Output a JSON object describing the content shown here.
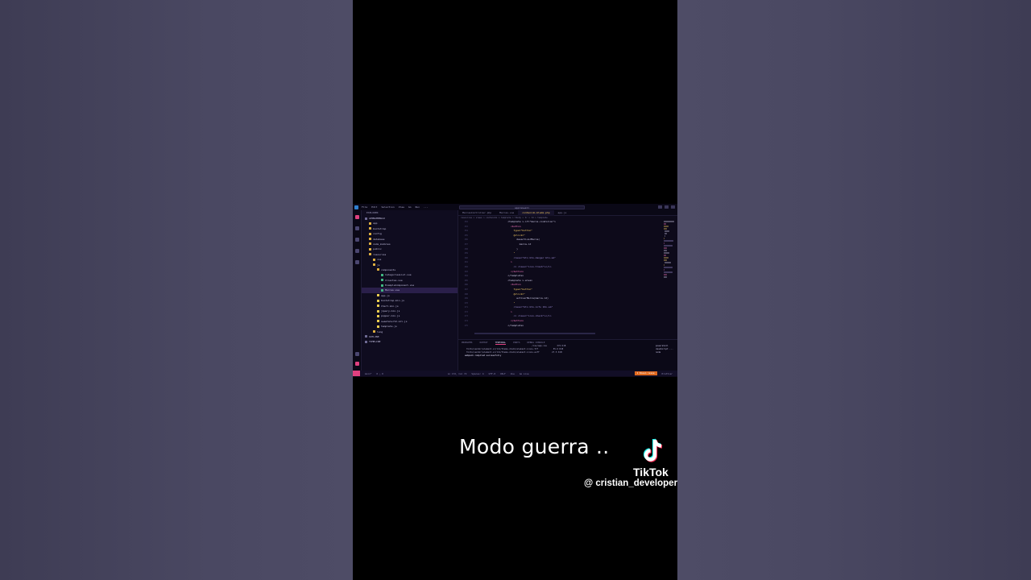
{
  "overlay": {
    "caption": "Modo guerra ..",
    "brand": "TikTok",
    "username": "@ cristian_developer"
  },
  "vscode": {
    "menu": [
      "File",
      "Edit",
      "Selection",
      "View",
      "Go",
      "Run",
      "···"
    ],
    "command_center": "appraswell",
    "sidebar_header": "EXPLORER",
    "tree": [
      {
        "label": "APPNAMEBULD",
        "color": "#6f6b95"
      },
      {
        "label": "app",
        "color": "#e0b040"
      },
      {
        "label": "bootstrap",
        "color": "#e0b040"
      },
      {
        "label": "config",
        "color": "#e0b040"
      },
      {
        "label": "database",
        "color": "#e0b040"
      },
      {
        "label": "node_modules",
        "color": "#e0b040"
      },
      {
        "label": "public",
        "color": "#e0b040"
      },
      {
        "label": "resources",
        "color": "#e0b040"
      },
      {
        "label": "css",
        "color": "#e0b040"
      },
      {
        "label": "js",
        "color": "#e0b040"
      },
      {
        "label": "components",
        "color": "#e0b040"
      },
      {
        "label": "CategoriesList.vue",
        "color": "#41b883"
      },
      {
        "label": "Clientes.vue",
        "color": "#41b883"
      },
      {
        "label": "ExampleComponent.vue",
        "color": "#41b883"
      },
      {
        "label": "Marcas.vue",
        "color": "#41b883"
      },
      {
        "label": "app.js",
        "color": "#f0d050"
      },
      {
        "label": "bootstrap.min.js",
        "color": "#f0d050"
      },
      {
        "label": "Chart.min.js",
        "color": "#f0d050"
      },
      {
        "label": "jquery.min.js",
        "color": "#f0d050"
      },
      {
        "label": "popper.min.js",
        "color": "#f0d050"
      },
      {
        "label": "sweetalert2.all.js",
        "color": "#f0d050"
      },
      {
        "label": "template.js",
        "color": "#f0d050"
      },
      {
        "label": "lang",
        "color": "#e0b040"
      },
      {
        "label": "OUTLINE",
        "color": "#6f6b95"
      },
      {
        "label": "TIMELINE",
        "color": "#6f6b95"
      }
    ],
    "tabs": [
      "MarcasController.php",
      "Marcas.vue",
      "contenido.blade.php",
      "app.js"
    ],
    "active_tab_index": 2,
    "breadcrumbs": "resources > views > contenido > template > tbody > tr > td > template",
    "line_numbers": [
      "152",
      "153",
      "154",
      "155",
      "156",
      "157",
      "158",
      "159",
      "160",
      "161",
      "162",
      "163",
      "164",
      "165",
      "166",
      "167",
      "168",
      "169",
      "170",
      "171",
      "172",
      "173",
      "174",
      "175"
    ],
    "code_lines": [
      {
        "text": "                        <template v-if=\"marca.condicion\">",
        "color": "#d6d2f0"
      },
      {
        "text": "                          <button",
        "color": "#ff7ac6"
      },
      {
        "text": "                            type=\"button\"",
        "color": "#ffd466"
      },
      {
        "text": "                            @click=\"",
        "color": "#ffd466"
      },
      {
        "text": "                              desactivarMarca(",
        "color": "#d6d2f0"
      },
      {
        "text": "                                marca.id",
        "color": "#d6d2f0"
      },
      {
        "text": "                              )",
        "color": "#d6d2f0"
      },
      {
        "text": "                            \"",
        "color": "#ffd466"
      },
      {
        "text": "                            class=\"btn btn-danger btn-sm\"",
        "color": "#9f8fd8"
      },
      {
        "text": "                          >",
        "color": "#ff7ac6"
      },
      {
        "text": "                            <i class=\"icon-trash\"></i>",
        "color": "#9f8fd8"
      },
      {
        "text": "                          </button>",
        "color": "#ff7ac6"
      },
      {
        "text": "                        </template>",
        "color": "#d6d2f0"
      },
      {
        "text": "                        <template v-else>",
        "color": "#d6d2f0"
      },
      {
        "text": "                          <button",
        "color": "#ff7ac6"
      },
      {
        "text": "                            type=\"button\"",
        "color": "#ffd466"
      },
      {
        "text": "                            @click=\"",
        "color": "#ffd466"
      },
      {
        "text": "                              activarMarca(marca.id)",
        "color": "#d6d2f0"
      },
      {
        "text": "                            \"",
        "color": "#ffd466"
      },
      {
        "text": "                            class=\"btn btn-info btn-sm\"",
        "color": "#9f8fd8"
      },
      {
        "text": "                          >",
        "color": "#ff7ac6"
      },
      {
        "text": "                            <i class=\"icon-check\"></i>",
        "color": "#9f8fd8"
      },
      {
        "text": "                          </button>",
        "color": "#ff7ac6"
      },
      {
        "text": "                        </template>",
        "color": "#d6d2f0"
      }
    ],
    "panel_tabs": [
      "PROBLEMS",
      "OUTPUT",
      "TERMINAL",
      "PORTS",
      "DEBUG CONSOLE"
    ],
    "active_panel_tab": 2,
    "terminal_lines": [
      "                                                    /css/app.css        372 KiB",
      "fonts/vendor/element-ui/lib/theme-chalk/element-icons.ttf            55.6 KiB",
      "fonts/vendor/element-ui/lib/theme-chalk/element-icons.woff          27.5 KiB"
    ],
    "terminal_success": "webpack compiled successfully",
    "terminals": [
      "powershell",
      "JavaScript ...",
      "node"
    ],
    "status_items": [
      "main*",
      "0 △ 0",
      "Ln 172, Col 72",
      "Spaces: 4",
      "UTF-8",
      "CRLF",
      "Vue",
      "Go Live",
      "Prettier"
    ],
    "status_warn": "1 Known issue"
  }
}
